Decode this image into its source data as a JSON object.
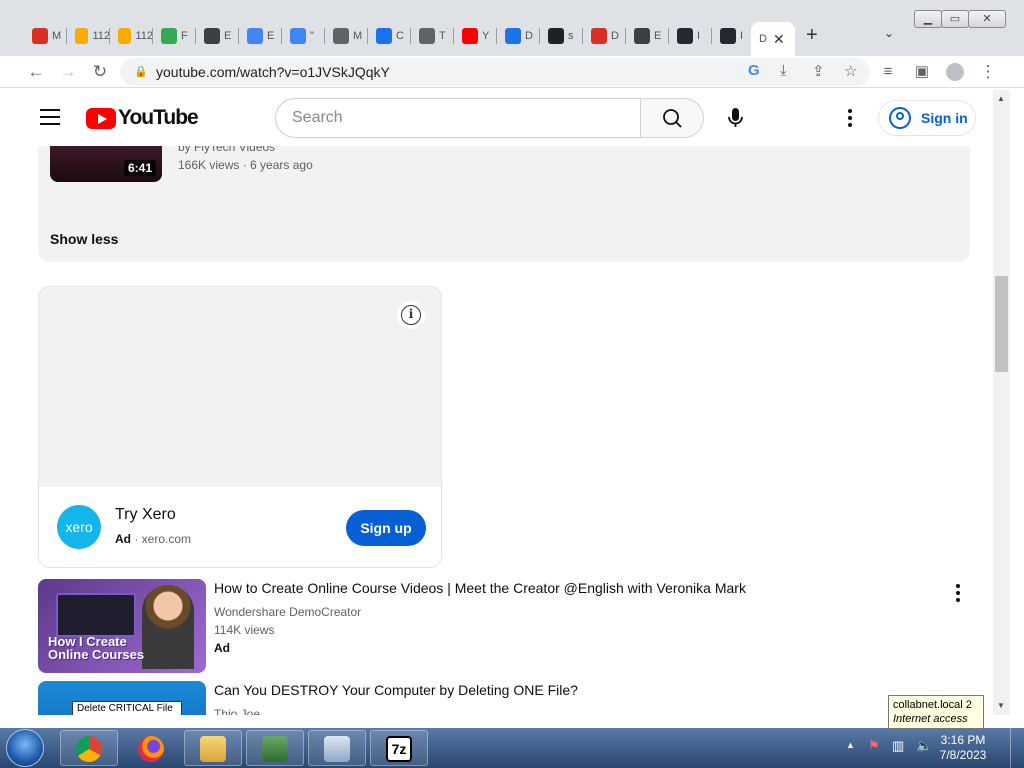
{
  "browser": {
    "tabs": [
      {
        "favicon": "gmail-icon",
        "label": "M",
        "color": "#d93025"
      },
      {
        "favicon": "site-112-icon",
        "label": "112",
        "color": "#f9ab00"
      },
      {
        "favicon": "site-112-icon",
        "label": "112",
        "color": "#f9ab00"
      },
      {
        "favicon": "play-store-icon",
        "label": "F",
        "color": "#34a853"
      },
      {
        "favicon": "globe-icon",
        "label": "E",
        "color": "#3c4043"
      },
      {
        "favicon": "google-icon",
        "label": "E",
        "color": "#4285f4"
      },
      {
        "favicon": "google-icon",
        "label": "\"",
        "color": "#4285f4"
      },
      {
        "favicon": "generic-icon",
        "label": "M",
        "color": "#5f6368"
      },
      {
        "favicon": "chrome-icon",
        "label": "C",
        "color": "#1a73e8"
      },
      {
        "favicon": "generic-icon",
        "label": "T",
        "color": "#5f6368"
      },
      {
        "favicon": "youtube-icon",
        "label": "Y",
        "color": "#ff0000"
      },
      {
        "favicon": "download-icon",
        "label": "D",
        "color": "#1a73e8"
      },
      {
        "favicon": "generic-icon",
        "label": "s",
        "color": "#202124"
      },
      {
        "favicon": "calendar-icon",
        "label": "D",
        "color": "#d93025"
      },
      {
        "favicon": "globe-icon",
        "label": "E",
        "color": "#3c4043"
      },
      {
        "favicon": "github-icon",
        "label": "I",
        "color": "#24292f"
      },
      {
        "favicon": "github-icon",
        "label": "I",
        "color": "#24292f"
      }
    ],
    "active_tab_label": "D",
    "url": "youtube.com/watch?v=o1JVSkJQqkY"
  },
  "youtube": {
    "logo_text": "YouTube",
    "search_placeholder": "Search",
    "sign_in_label": "Sign in",
    "description": {
      "prev_video_duration": "6:41",
      "prev_video_by": "by FlyTech Videos",
      "prev_video_views": "166K views · 6 years ago",
      "show_less": "Show less"
    },
    "ad": {
      "logo_text": "xero",
      "title": "Try Xero",
      "ad_label": "Ad",
      "domain": "· xero.com",
      "cta": "Sign up"
    },
    "recommendations": [
      {
        "title": "How to Create Online Course Videos | Meet the Creator @English with Veronika Mark",
        "channel": "Wondershare DemoCreator",
        "meta": "114K views",
        "badge": "Ad",
        "thumb_text": "How I Create Online Courses"
      },
      {
        "title": "Can You DESTROY Your Computer by Deleting ONE File?",
        "channel": "Thio Joe",
        "meta": "",
        "badge": "",
        "thumb_text": "Delete CRITICAL File"
      }
    ]
  },
  "tooltip": {
    "line1": "collabnet.local 2",
    "line2": "Internet access"
  },
  "taskbar": {
    "time": "3:16 PM",
    "date": "7/8/2023",
    "apps": [
      "chrome-icon",
      "firefox-icon",
      "explorer-icon",
      "network-icon",
      "keyboard-icon",
      "7zip-icon"
    ],
    "seven_zip_label": "7z"
  }
}
